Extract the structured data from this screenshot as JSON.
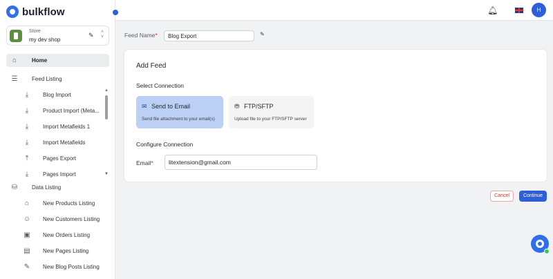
{
  "brand": {
    "name": "bulkflow"
  },
  "store": {
    "label": "Store",
    "name": "my dev shop"
  },
  "nav": {
    "home": "Home",
    "feed_listing": {
      "label": "Feed Listing",
      "items": [
        {
          "label": "Blog Import",
          "icon": "download-icon"
        },
        {
          "label": "Product Import (Meta...",
          "icon": "download-icon"
        },
        {
          "label": "Import Metafields 1",
          "icon": "download-icon"
        },
        {
          "label": "Import Metafields",
          "icon": "download-icon"
        },
        {
          "label": "Pages Export",
          "icon": "upload-icon"
        },
        {
          "label": "Pages Import",
          "icon": "download-icon"
        }
      ]
    },
    "data_listing": {
      "label": "Data Listing",
      "items": [
        {
          "label": "New Products Listing",
          "icon": "product-tag-icon"
        },
        {
          "label": "New Customers Listing",
          "icon": "customer-icon"
        },
        {
          "label": "New Orders Listing",
          "icon": "order-icon"
        },
        {
          "label": "New Pages Listing",
          "icon": "page-icon"
        },
        {
          "label": "New Blog Posts Listing",
          "icon": "blog-post-icon"
        }
      ]
    }
  },
  "topbar": {
    "avatar_initial": "H"
  },
  "feed_name": {
    "label": "Feed Name",
    "required_mark": "*",
    "value": "Blog Export"
  },
  "card": {
    "title": "Add Feed",
    "select_connection": "Select Connection",
    "options": [
      {
        "title": "Send to Email",
        "description": "Send file attachment to your email(s)",
        "selected": true
      },
      {
        "title": "FTP/SFTP",
        "description": "Upload file to your FTP/SFTP server",
        "selected": false
      }
    ],
    "configure_connection": "Configure Connection",
    "email": {
      "label": "Email",
      "required_mark": "*",
      "value": "litextension@gmail.com"
    }
  },
  "actions": {
    "cancel": "Cancel",
    "continue": "Continue"
  },
  "colors": {
    "accent": "#2f5ed9",
    "selected_option": "#bcd0f6",
    "danger": "#c53c2b"
  }
}
